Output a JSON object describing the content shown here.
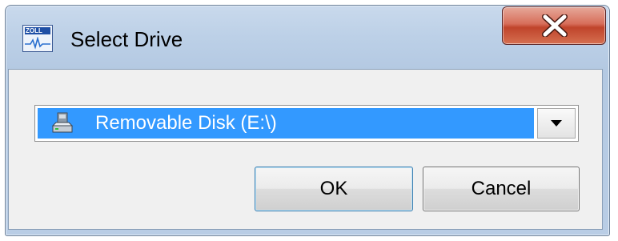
{
  "window": {
    "title": "Select Drive"
  },
  "app_icon": {
    "name": "zoll-app-icon",
    "brand_text": "ZOLL"
  },
  "close_button": {
    "icon": "close-x-icon",
    "color": "#c7492f"
  },
  "drive_select": {
    "selected_value": "Removable Disk (E:\\)",
    "icon": "removable-disk-icon",
    "highlight_color": "#3399ff"
  },
  "buttons": {
    "ok_label": "OK",
    "cancel_label": "Cancel"
  }
}
